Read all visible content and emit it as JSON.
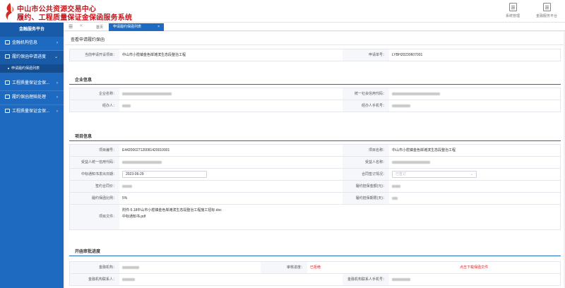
{
  "header": {
    "title_line1": "中山市公共资源交易中心",
    "title_line2": "履约、工程质量保证金保函服务系统",
    "actions": [
      {
        "label": "系统管理",
        "icon": "document-icon"
      },
      {
        "label": "金融服务平台",
        "icon": "document-icon"
      }
    ]
  },
  "sidebar": {
    "header": "金融服务平台",
    "items": [
      {
        "label": "金融机构信息",
        "open": false
      },
      {
        "label": "履约保函申请进度",
        "open": true,
        "sub": "申请履约保函列表"
      },
      {
        "label": "工程质量保证金保...",
        "open": false
      },
      {
        "label": "履约保函理赔处理",
        "open": false
      },
      {
        "label": "工程质量保证金保...",
        "open": false
      }
    ]
  },
  "tabs": {
    "menu_icon": "☰",
    "back_icon": "«",
    "home": "首页",
    "active": "申请履约保函列表",
    "close": "×"
  },
  "page": {
    "title": "查看申请履约保函",
    "project_label": "当前申请开设项目：",
    "project_value": "中山市小榄镇金色岸滩滨生态段整治工程",
    "apply_no_label": "申请单号：",
    "apply_no_value": "LYBH20230607001"
  },
  "company": {
    "section": "企业信息",
    "name_label": "企业名称：",
    "credit_label": "统一社会信用代码：",
    "agent_label": "经办人：",
    "agent_phone_label": "经办人手机号："
  },
  "project": {
    "section": "项目信息",
    "code_label": "项目编号：",
    "code_value": "E44200027120081420010001",
    "name_label": "项目名称：",
    "name_value": "中山市小榄镇金色岸滩滨生态段整治工程",
    "beneficiary_code_label": "受益人统一信用代码：",
    "beneficiary_name_label": "受益人名称：",
    "notice_date_label": "中标通知书发出日期：",
    "notice_date_value": "2023-06-29",
    "contract_signed_label": "合同签订情况：",
    "contract_signed_placeholder": "已签订",
    "contract_amount_label": "签约合同价：",
    "perf_amount_label": "履约担保金额(元)：",
    "perf_rate_label": "履约保函比例：",
    "perf_rate_value": "5%",
    "perf_period_label": "履约担保期限(天)：",
    "files_label": "项目文件：",
    "file1": "附件-5.18中山市小榄镇金色岸滩滨生态段整治工程施工招标.doc",
    "file2": "中标通知书.pdf"
  },
  "progress": {
    "section": "开函审批进度",
    "bank_label": "金融机构：",
    "review_label": "审核进度：",
    "review_value": "已拒绝",
    "download_link": "点击下载保函文件",
    "bank_contact_label": "金融机构联系人：",
    "bank_contact_phone_label": "金融机构联系人手机号："
  }
}
